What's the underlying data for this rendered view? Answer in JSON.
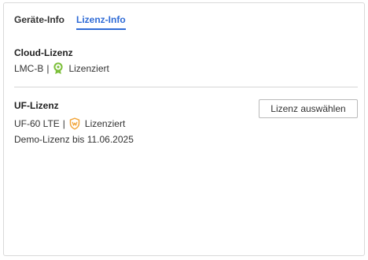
{
  "tabs": [
    {
      "label": "Geräte-Info",
      "active": false
    },
    {
      "label": "Lizenz-Info",
      "active": true
    }
  ],
  "cloud": {
    "title": "Cloud-Lizenz",
    "model": "LMC-B",
    "separator": "|",
    "status": "Lizenziert",
    "status_icon": "license-badge-green-icon",
    "status_color": "#7cbf3a"
  },
  "uf": {
    "title": "UF-Lizenz",
    "model": "UF-60 LTE",
    "separator": "|",
    "status": "Lizenziert",
    "status_icon": "shield-orange-icon",
    "status_color": "#f2a63b",
    "demo_text": "Demo-Lizenz bis 11.06.2025",
    "select_button": "Lizenz auswählen"
  },
  "colors": {
    "accent": "#2f6bd6",
    "border": "#d9d9d9"
  }
}
